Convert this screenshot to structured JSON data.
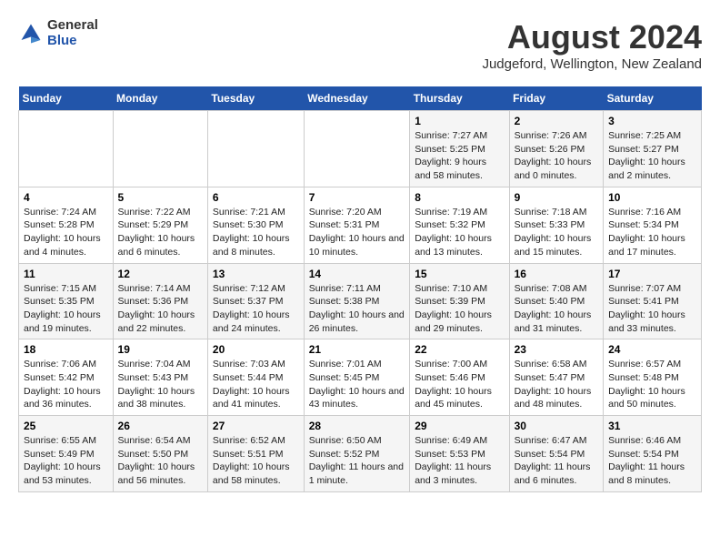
{
  "logo": {
    "general": "General",
    "blue": "Blue"
  },
  "title": "August 2024",
  "subtitle": "Judgeford, Wellington, New Zealand",
  "header_days": [
    "Sunday",
    "Monday",
    "Tuesday",
    "Wednesday",
    "Thursday",
    "Friday",
    "Saturday"
  ],
  "weeks": [
    [
      {
        "day": "",
        "sunrise": "",
        "sunset": "",
        "daylight": ""
      },
      {
        "day": "",
        "sunrise": "",
        "sunset": "",
        "daylight": ""
      },
      {
        "day": "",
        "sunrise": "",
        "sunset": "",
        "daylight": ""
      },
      {
        "day": "",
        "sunrise": "",
        "sunset": "",
        "daylight": ""
      },
      {
        "day": "1",
        "sunrise": "Sunrise: 7:27 AM",
        "sunset": "Sunset: 5:25 PM",
        "daylight": "Daylight: 9 hours and 58 minutes."
      },
      {
        "day": "2",
        "sunrise": "Sunrise: 7:26 AM",
        "sunset": "Sunset: 5:26 PM",
        "daylight": "Daylight: 10 hours and 0 minutes."
      },
      {
        "day": "3",
        "sunrise": "Sunrise: 7:25 AM",
        "sunset": "Sunset: 5:27 PM",
        "daylight": "Daylight: 10 hours and 2 minutes."
      }
    ],
    [
      {
        "day": "4",
        "sunrise": "Sunrise: 7:24 AM",
        "sunset": "Sunset: 5:28 PM",
        "daylight": "Daylight: 10 hours and 4 minutes."
      },
      {
        "day": "5",
        "sunrise": "Sunrise: 7:22 AM",
        "sunset": "Sunset: 5:29 PM",
        "daylight": "Daylight: 10 hours and 6 minutes."
      },
      {
        "day": "6",
        "sunrise": "Sunrise: 7:21 AM",
        "sunset": "Sunset: 5:30 PM",
        "daylight": "Daylight: 10 hours and 8 minutes."
      },
      {
        "day": "7",
        "sunrise": "Sunrise: 7:20 AM",
        "sunset": "Sunset: 5:31 PM",
        "daylight": "Daylight: 10 hours and 10 minutes."
      },
      {
        "day": "8",
        "sunrise": "Sunrise: 7:19 AM",
        "sunset": "Sunset: 5:32 PM",
        "daylight": "Daylight: 10 hours and 13 minutes."
      },
      {
        "day": "9",
        "sunrise": "Sunrise: 7:18 AM",
        "sunset": "Sunset: 5:33 PM",
        "daylight": "Daylight: 10 hours and 15 minutes."
      },
      {
        "day": "10",
        "sunrise": "Sunrise: 7:16 AM",
        "sunset": "Sunset: 5:34 PM",
        "daylight": "Daylight: 10 hours and 17 minutes."
      }
    ],
    [
      {
        "day": "11",
        "sunrise": "Sunrise: 7:15 AM",
        "sunset": "Sunset: 5:35 PM",
        "daylight": "Daylight: 10 hours and 19 minutes."
      },
      {
        "day": "12",
        "sunrise": "Sunrise: 7:14 AM",
        "sunset": "Sunset: 5:36 PM",
        "daylight": "Daylight: 10 hours and 22 minutes."
      },
      {
        "day": "13",
        "sunrise": "Sunrise: 7:12 AM",
        "sunset": "Sunset: 5:37 PM",
        "daylight": "Daylight: 10 hours and 24 minutes."
      },
      {
        "day": "14",
        "sunrise": "Sunrise: 7:11 AM",
        "sunset": "Sunset: 5:38 PM",
        "daylight": "Daylight: 10 hours and 26 minutes."
      },
      {
        "day": "15",
        "sunrise": "Sunrise: 7:10 AM",
        "sunset": "Sunset: 5:39 PM",
        "daylight": "Daylight: 10 hours and 29 minutes."
      },
      {
        "day": "16",
        "sunrise": "Sunrise: 7:08 AM",
        "sunset": "Sunset: 5:40 PM",
        "daylight": "Daylight: 10 hours and 31 minutes."
      },
      {
        "day": "17",
        "sunrise": "Sunrise: 7:07 AM",
        "sunset": "Sunset: 5:41 PM",
        "daylight": "Daylight: 10 hours and 33 minutes."
      }
    ],
    [
      {
        "day": "18",
        "sunrise": "Sunrise: 7:06 AM",
        "sunset": "Sunset: 5:42 PM",
        "daylight": "Daylight: 10 hours and 36 minutes."
      },
      {
        "day": "19",
        "sunrise": "Sunrise: 7:04 AM",
        "sunset": "Sunset: 5:43 PM",
        "daylight": "Daylight: 10 hours and 38 minutes."
      },
      {
        "day": "20",
        "sunrise": "Sunrise: 7:03 AM",
        "sunset": "Sunset: 5:44 PM",
        "daylight": "Daylight: 10 hours and 41 minutes."
      },
      {
        "day": "21",
        "sunrise": "Sunrise: 7:01 AM",
        "sunset": "Sunset: 5:45 PM",
        "daylight": "Daylight: 10 hours and 43 minutes."
      },
      {
        "day": "22",
        "sunrise": "Sunrise: 7:00 AM",
        "sunset": "Sunset: 5:46 PM",
        "daylight": "Daylight: 10 hours and 45 minutes."
      },
      {
        "day": "23",
        "sunrise": "Sunrise: 6:58 AM",
        "sunset": "Sunset: 5:47 PM",
        "daylight": "Daylight: 10 hours and 48 minutes."
      },
      {
        "day": "24",
        "sunrise": "Sunrise: 6:57 AM",
        "sunset": "Sunset: 5:48 PM",
        "daylight": "Daylight: 10 hours and 50 minutes."
      }
    ],
    [
      {
        "day": "25",
        "sunrise": "Sunrise: 6:55 AM",
        "sunset": "Sunset: 5:49 PM",
        "daylight": "Daylight: 10 hours and 53 minutes."
      },
      {
        "day": "26",
        "sunrise": "Sunrise: 6:54 AM",
        "sunset": "Sunset: 5:50 PM",
        "daylight": "Daylight: 10 hours and 56 minutes."
      },
      {
        "day": "27",
        "sunrise": "Sunrise: 6:52 AM",
        "sunset": "Sunset: 5:51 PM",
        "daylight": "Daylight: 10 hours and 58 minutes."
      },
      {
        "day": "28",
        "sunrise": "Sunrise: 6:50 AM",
        "sunset": "Sunset: 5:52 PM",
        "daylight": "Daylight: 11 hours and 1 minute."
      },
      {
        "day": "29",
        "sunrise": "Sunrise: 6:49 AM",
        "sunset": "Sunset: 5:53 PM",
        "daylight": "Daylight: 11 hours and 3 minutes."
      },
      {
        "day": "30",
        "sunrise": "Sunrise: 6:47 AM",
        "sunset": "Sunset: 5:54 PM",
        "daylight": "Daylight: 11 hours and 6 minutes."
      },
      {
        "day": "31",
        "sunrise": "Sunrise: 6:46 AM",
        "sunset": "Sunset: 5:54 PM",
        "daylight": "Daylight: 11 hours and 8 minutes."
      }
    ]
  ]
}
